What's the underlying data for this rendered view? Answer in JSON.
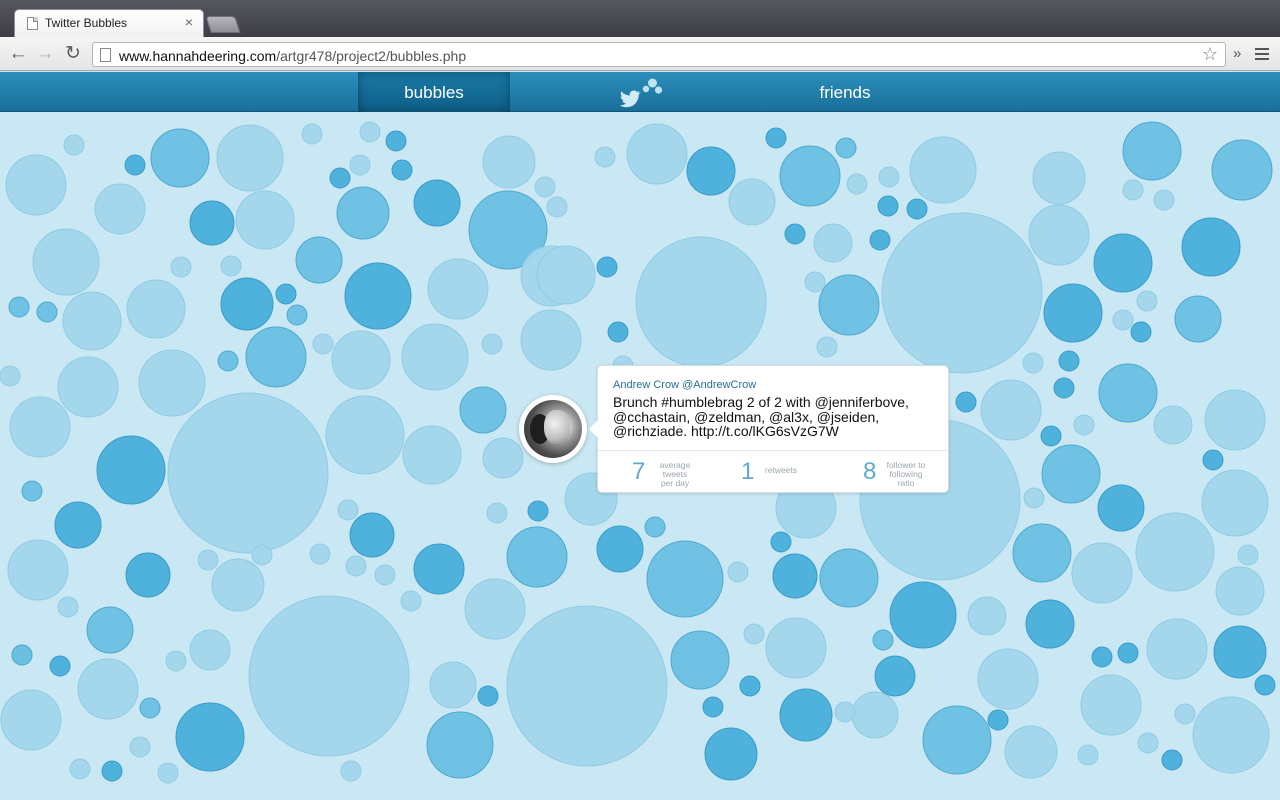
{
  "browser": {
    "tab_title": "Twitter Bubbles",
    "tab_close": "×",
    "url_host": "www.hannahdeering.com",
    "url_path": "/artgr478/project2/bubbles.php",
    "back_glyph": "←",
    "forward_glyph": "→",
    "reload_glyph": "↻",
    "star_glyph": "☆",
    "ext_glyph": "»"
  },
  "nav": {
    "bubbles_label": "bubbles",
    "friends_label": "friends",
    "active": "bubbles"
  },
  "colors": {
    "page_bg": "#c9e8f4",
    "header": "#1e7aa8",
    "bubble_light": "#a2d6eb",
    "bubble_mid": "#6ac0e2",
    "bubble_dark": "#4fb2dc",
    "stat_number": "#5fa9ce"
  },
  "tweet": {
    "author": "Andrew Crow @AndrewCrow",
    "text": "Brunch #humblebrag 2 of 2 with @jenniferbove, @cchastain, @zeldman, @al3x, @jseiden, @richziade. http://t.co/lKG6sVzG7W",
    "stats": {
      "tweets_per_day": {
        "value": "7",
        "label": "average tweets per day"
      },
      "retweets": {
        "value": "1",
        "label": "retweets"
      },
      "ratio": {
        "value": "8",
        "label": "follower to following ratio"
      }
    }
  }
}
